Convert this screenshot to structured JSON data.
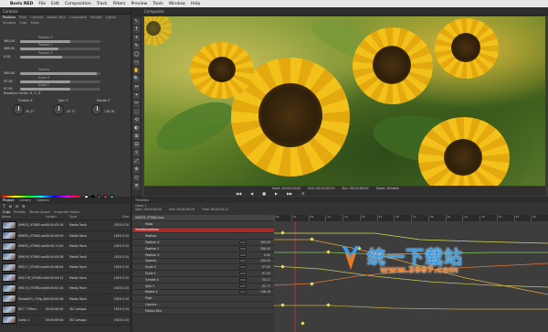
{
  "menubar": {
    "app_name": "Boris RED",
    "items": [
      "File",
      "Edit",
      "Composition",
      "Track",
      "Filters",
      "Preview",
      "Tools",
      "Window",
      "Help"
    ]
  },
  "controls": {
    "title": "Controls",
    "tabs": [
      "Position",
      "Pixel",
      "Camera",
      "Motion Blur",
      "Composite",
      "Render",
      "Lights"
    ],
    "subtabs": [
      "Shadow",
      "Crop",
      "Mask"
    ],
    "params": [
      {
        "value": "360.00",
        "label": "Position X",
        "fill": 0.62
      },
      {
        "value": "288.00",
        "label": "Position Y",
        "fill": 0.48
      },
      {
        "value": "0.00",
        "label": "Position Z",
        "fill": 0.52
      },
      {
        "value": "100.00",
        "label": "Opacity",
        "fill": 0.95
      },
      {
        "value": "97.00",
        "label": "Scale X",
        "fill": 0.62
      },
      {
        "value": "97.00",
        "label": "Scale Y",
        "fill": 0.62
      }
    ],
    "rotation_order_label": "Rotation Order",
    "rotation_order_value": "X, Y, Z",
    "rotations": [
      {
        "label": "Tumble X",
        "value": "30.17"
      },
      {
        "label": "Spin Y",
        "value": "-33.77"
      },
      {
        "label": "Rotate Z",
        "value": "138.76"
      }
    ]
  },
  "tools": [
    "↖",
    "T",
    "+",
    "✎",
    "◯",
    "▭",
    "✋",
    "🔍",
    "↔",
    "⌖",
    "✂",
    "⬚",
    "⟲",
    "◐",
    "⊞",
    "⊡",
    "⇧",
    "⤢",
    "⊕",
    "◇",
    "≡"
  ],
  "composite": {
    "title": "Composite",
    "transport": {
      "start": "Start: 00;00;00;00",
      "end": "End: 00;00;05;29",
      "duration": "Dur: 00;00;06;00",
      "zoom": "Zoom: Window"
    },
    "buttons": [
      "◀◀",
      "◀",
      "■",
      "▶",
      "▶▶",
      "⟳"
    ]
  },
  "project": {
    "tabs": [
      "Project",
      "Library",
      "Options"
    ],
    "toolbar": [
      "T",
      "⊞",
      "⊟",
      "⚙"
    ],
    "subtabs": [
      "Cuts",
      "Presets",
      "Media Space",
      "Imported Media"
    ],
    "columns": [
      "Name",
      "Length",
      "Type",
      "Size"
    ],
    "rows": [
      {
        "name": "0MH23_VTSHD.mov",
        "length": "00:00:03:16",
        "type": "Media Track",
        "size": "1920 X 10"
      },
      {
        "name": "0MH32_VTSHD.mov",
        "length": "00:00:05:09",
        "type": "Media Track",
        "size": "1920 X 10"
      },
      {
        "name": "0MH32_VTSHD.mov",
        "length": "00:00:11:00",
        "type": "Media Track",
        "size": "1920 X 10"
      },
      {
        "name": "0MH79_VTSHD.mov",
        "length": "00:00:05:06",
        "type": "Media Track",
        "size": "1920 X 10"
      },
      {
        "name": "0M117_VTSHD.mov",
        "length": "00:00:06:04",
        "type": "Media Track",
        "size": "1920 X 10"
      },
      {
        "name": "0M1178_VTSHD.mov",
        "length": "00:00:04:13",
        "type": "Media Track",
        "size": "1920 X 10"
      },
      {
        "name": "0M174_VTSHD.mov",
        "length": "00:00:01:16",
        "type": "Media Track",
        "size": "1920 X 10"
      },
      {
        "name": "Sheep001_720p_Andfr",
        "length": "00:00:00:28",
        "type": "Media Track",
        "size": "1920 X 10"
      },
      {
        "name": "BCC 7 Filters",
        "length": "00:00:00:00",
        "type": "3D Compos",
        "size": "1920 X 10"
      },
      {
        "name": "Comp 1",
        "length": "00:00:09:00",
        "type": "3D Compos",
        "size": "1920 X 10"
      }
    ]
  },
  "timeline": {
    "title": "Timeline",
    "comp": "Comp 1",
    "info": [
      "Start: 00;00;00;00",
      "End: 00;00;05;29",
      "Time: 00;00;02;11"
    ],
    "ruler": [
      "00",
      "04",
      "08",
      "12",
      "16",
      "20",
      "24",
      "28",
      "32",
      "36",
      "40",
      "44",
      "48",
      "52",
      "56",
      "60"
    ],
    "tracks": [
      {
        "label": "0MH79_VTSHD.mov",
        "kind": "header",
        "value": ""
      },
      {
        "label": "Mask",
        "kind": "sub",
        "value": ""
      },
      {
        "label": "Transformations",
        "kind": "red",
        "value": ""
      },
      {
        "label": "Position",
        "kind": "sub",
        "value": ""
      },
      {
        "label": "Position X",
        "kind": "sub",
        "value": "360.00"
      },
      {
        "label": "Position Y",
        "kind": "sub",
        "value": "288.00"
      },
      {
        "label": "Position Z",
        "kind": "sub",
        "value": "0.00"
      },
      {
        "label": "Opacity",
        "kind": "sub",
        "value": "100.00"
      },
      {
        "label": "Scale X",
        "kind": "sub",
        "value": "97.00"
      },
      {
        "label": "Scale Y",
        "kind": "sub",
        "value": "97.00"
      },
      {
        "label": "Tumble X",
        "kind": "sub",
        "value": "30.17"
      },
      {
        "label": "Spin Y",
        "kind": "sub",
        "value": "-33.77"
      },
      {
        "label": "Rotate Z",
        "kind": "sub",
        "value": "138.76"
      },
      {
        "label": "Pixel",
        "kind": "sub",
        "value": ""
      },
      {
        "label": "Camera",
        "kind": "sub",
        "value": ""
      },
      {
        "label": "Motion Blur",
        "kind": "sub",
        "value": ""
      }
    ]
  },
  "watermark": {
    "text": "统一下载站",
    "url": "www.3987.com"
  },
  "colors": {
    "accent_red": "#a82a2a",
    "menubar_bg": "#e6e6e6",
    "panel_bg": "#3a3a3a",
    "watermark_blue": "#3a9ee6",
    "watermark_orange": "#f07a1a"
  }
}
